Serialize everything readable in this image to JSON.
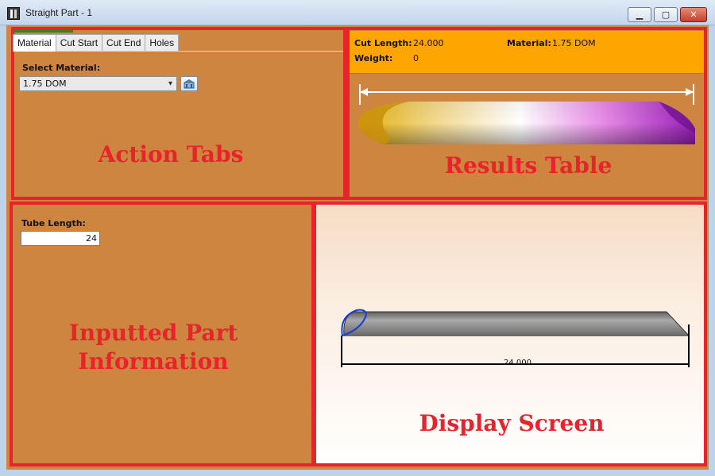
{
  "window": {
    "title": "Straight Part - 1"
  },
  "titlebar_buttons": {
    "minimize": "▁",
    "maximize": "▢",
    "close": "✕"
  },
  "tabs": [
    {
      "label": "Material",
      "active": true
    },
    {
      "label": "Cut Start",
      "active": false
    },
    {
      "label": "Cut End",
      "active": false
    },
    {
      "label": "Holes",
      "active": false
    }
  ],
  "material_tab": {
    "select_label": "Select Material:",
    "selected_value": "1.75 DOM"
  },
  "results": {
    "cut_length_label": "Cut Length:",
    "cut_length_value": "24.000",
    "material_label": "Material:",
    "material_value": "1.75 DOM",
    "weight_label": "Weight:",
    "weight_value": "0"
  },
  "inputs": {
    "tube_length_label": "Tube Length:",
    "tube_length_value": "24"
  },
  "display": {
    "dimension_value": "24.000"
  },
  "annotations": {
    "action_tabs": "Action Tabs",
    "results_table": "Results Table",
    "inputted_part": "Inputted Part Information",
    "display_screen": "Display Screen"
  },
  "colors": {
    "panel_bg": "#cd853f",
    "results_header_bg": "#ffa500",
    "annotation_red": "#e8232b"
  }
}
